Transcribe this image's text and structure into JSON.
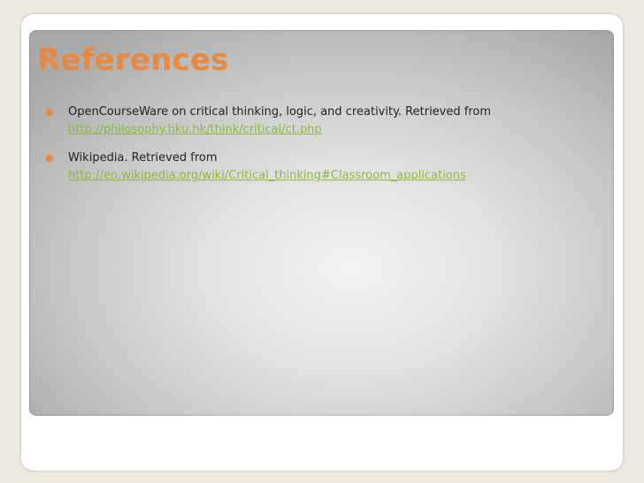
{
  "slide": {
    "title": "References",
    "bullet_glyph": "●",
    "references": [
      {
        "text": "OpenCourseWare on critical thinking, logic, and creativity. Retrieved from",
        "link": "http://philosophy.hku.hk/think/critical/ct.php"
      },
      {
        "text": "Wikipedia. Retrieved from",
        "link": "http://en.wikipedia.org/wiki/Critical_thinking#Classroom_applications"
      }
    ]
  },
  "colors": {
    "title": "#e8893f",
    "bullet": "#e8893f",
    "link": "#8db63f",
    "body_text": "#222222"
  }
}
